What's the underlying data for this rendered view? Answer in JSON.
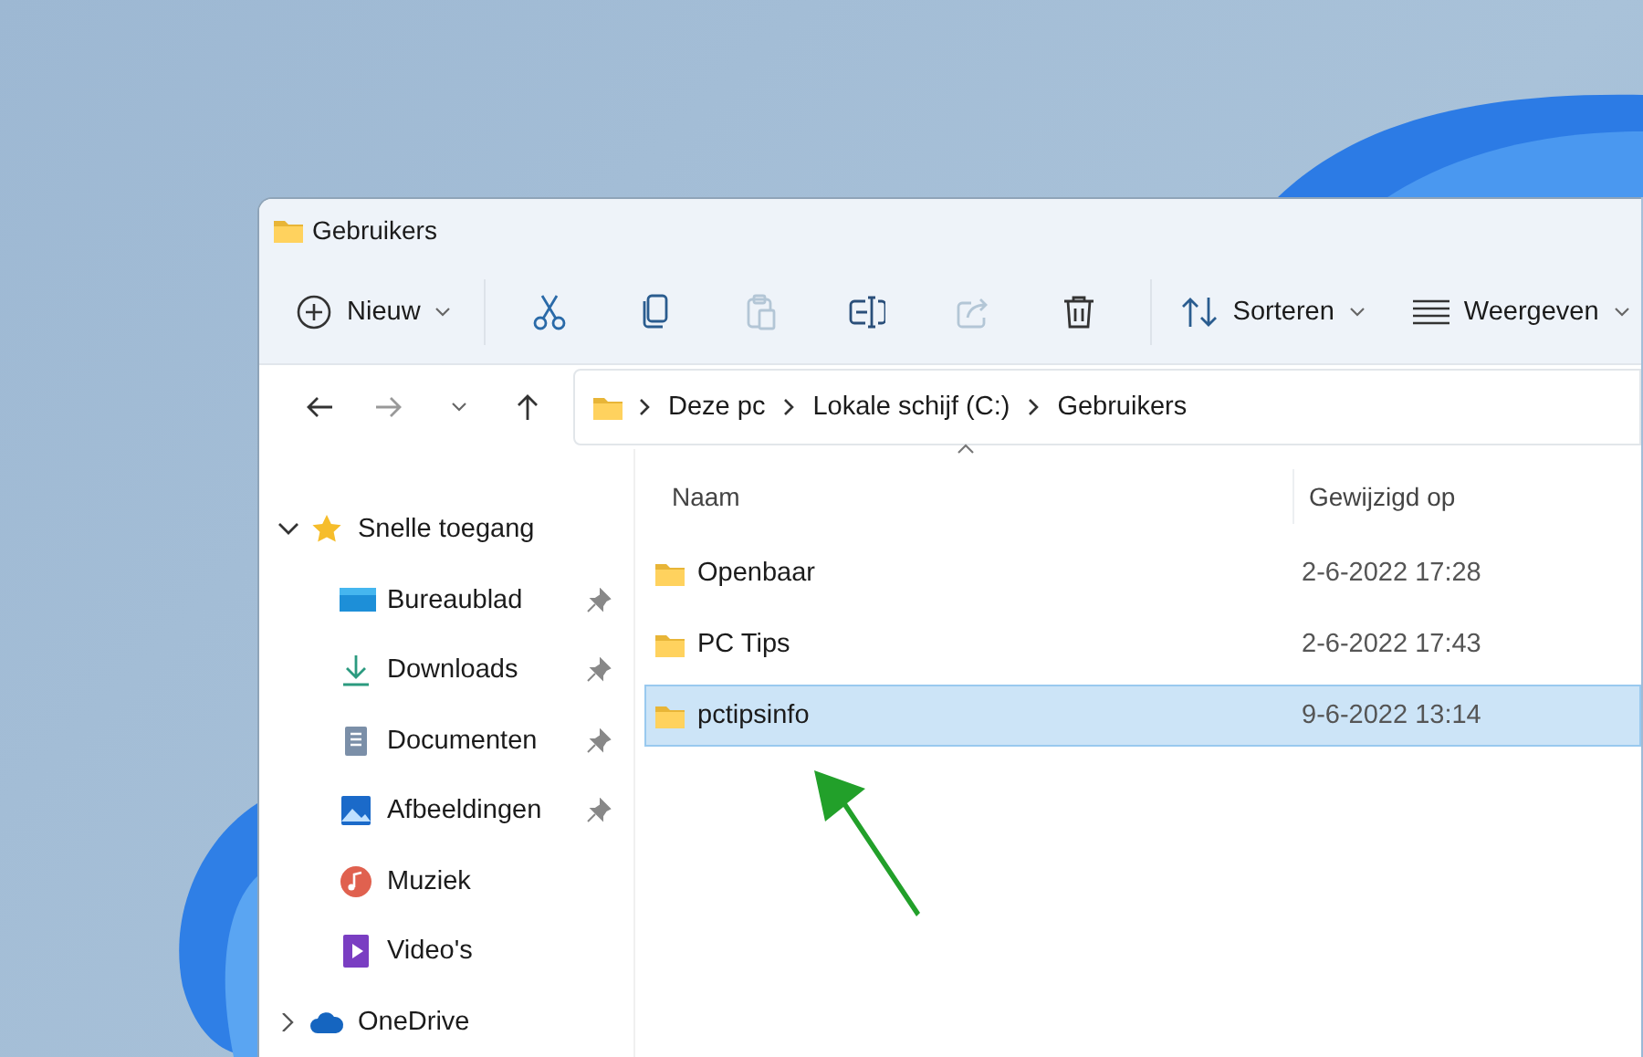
{
  "window": {
    "title": "Gebruikers"
  },
  "toolbar": {
    "new_button": {
      "label": "Nieuw"
    },
    "actions": [
      {
        "kind": "cut",
        "disabled": false
      },
      {
        "kind": "copy",
        "disabled": false
      },
      {
        "kind": "paste",
        "disabled": true
      },
      {
        "kind": "rename",
        "disabled": false
      },
      {
        "kind": "share",
        "disabled": true
      },
      {
        "kind": "delete",
        "disabled": false
      }
    ],
    "sort_button": {
      "label": "Sorteren"
    },
    "view_button": {
      "label": "Weergeven"
    }
  },
  "navigation": {
    "back": {
      "disabled": false
    },
    "forward": {
      "disabled": true
    }
  },
  "address_bar": {
    "crumbs": [
      "Deze pc",
      "Lokale schijf (C:)",
      "Gebruikers"
    ]
  },
  "sidebar": {
    "items": [
      {
        "label": "Snelle toegang",
        "kind": "star",
        "expanded": true,
        "children": [
          {
            "label": "Bureaublad",
            "kind": "desktop",
            "pinned": true
          },
          {
            "label": "Downloads",
            "kind": "downloads",
            "pinned": true
          },
          {
            "label": "Documenten",
            "kind": "documents",
            "pinned": true
          },
          {
            "label": "Afbeeldingen",
            "kind": "pictures",
            "pinned": true
          },
          {
            "label": "Muziek",
            "kind": "music",
            "pinned": false
          },
          {
            "label": "Video's",
            "kind": "videos",
            "pinned": false
          }
        ]
      },
      {
        "label": "OneDrive",
        "kind": "cloud",
        "expanded": false
      }
    ]
  },
  "file_list": {
    "columns": [
      "Naam",
      "Gewijzigd op"
    ],
    "rows": [
      {
        "name": "Openbaar",
        "modified": "2-6-2022 17:28",
        "selected": false
      },
      {
        "name": "PC Tips",
        "modified": "2-6-2022 17:43",
        "selected": false
      },
      {
        "name": "pctipsinfo",
        "modified": "9-6-2022 13:14",
        "selected": true
      }
    ]
  }
}
